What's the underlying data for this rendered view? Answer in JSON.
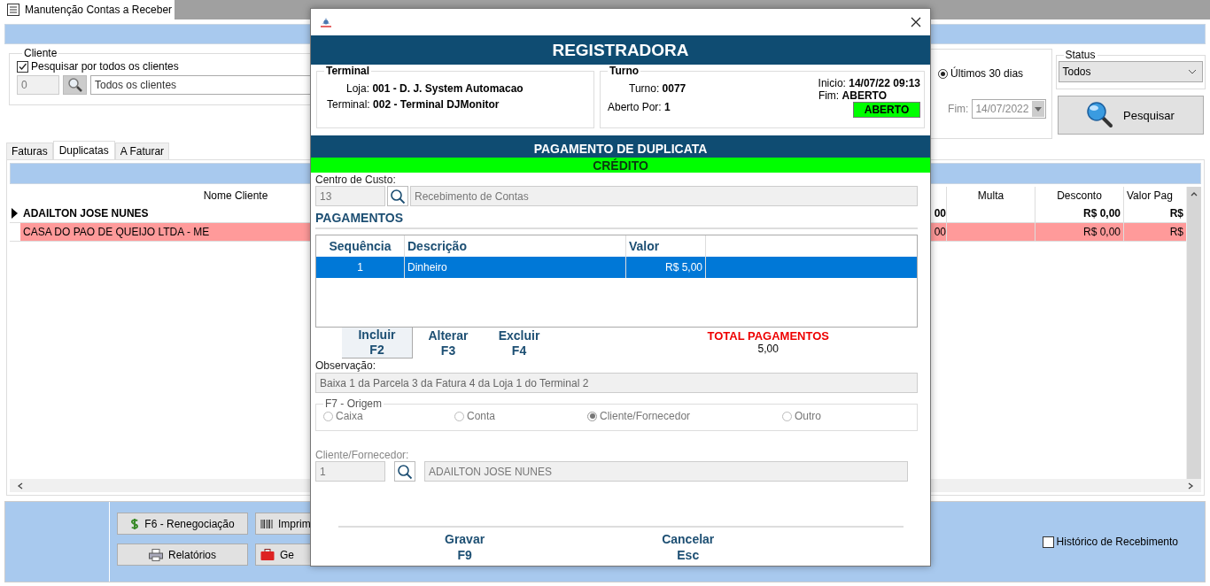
{
  "main_tab": {
    "title": "Manutenção Contas a Receber"
  },
  "cliente": {
    "legend": "Cliente",
    "search_all": {
      "label": "Pesquisar por todos os clientes",
      "checked": true
    },
    "code": "0",
    "name": "Todos os clientes"
  },
  "period": {
    "option": {
      "label": "Últimos 30 dias",
      "selected": true
    },
    "end_label": "Fim:",
    "end_date": "14/07/2022"
  },
  "status": {
    "legend": "Status",
    "value": "Todos"
  },
  "search_button": {
    "label": "Pesquisar"
  },
  "tabs": [
    {
      "label": "Faturas",
      "selected": false
    },
    {
      "label": "Duplicatas",
      "selected": true
    },
    {
      "label": "A Faturar",
      "selected": false
    }
  ],
  "grid": {
    "columns": {
      "nome": "Nome Cliente",
      "multa": "Multa",
      "desconto": "Desconto",
      "valor_pag": "Valor Pag"
    },
    "rows": [
      {
        "nome": "ADAILTON JOSE NUNES",
        "column_2": "00",
        "desconto": "R$ 0,00",
        "valor_pag": "R$",
        "selected": true,
        "highlighted": false
      },
      {
        "nome": "CASA DO PAO DE QUEIJO LTDA - ME",
        "column_2": "00",
        "desconto": "R$ 0,00",
        "valor_pag": "R$",
        "selected": false,
        "highlighted": true
      }
    ]
  },
  "bottom_buttons": [
    {
      "label": "F6 - Renegociação",
      "kind": "money"
    },
    {
      "label": "Imprim",
      "kind": "barcode"
    },
    {
      "label": "Relatórios",
      "kind": "printer"
    },
    {
      "label": "Ge",
      "kind": "case"
    }
  ],
  "historico": {
    "label": "Histórico de Recebimento",
    "checked": false
  },
  "dialog": {
    "title": "REGISTRADORA",
    "terminal": {
      "legend": "Terminal",
      "loja_label": "Loja:",
      "loja": "001 - D. J. System Automacao",
      "terminal_label": "Terminal:",
      "terminal": "002 - Terminal DJMonitor"
    },
    "turno": {
      "legend": "Turno",
      "turno_label": "Turno:",
      "turno": "0077",
      "aberto_por_label": "Aberto Por:",
      "aberto_por": "1",
      "inicio_label": "Inicio:",
      "inicio": "14/07/22 09:13",
      "fim_label": "Fim:",
      "fim": "ABERTO",
      "status": "ABERTO"
    },
    "section": "PAGAMENTO DE DUPLICATA",
    "operation": "CRÉDITO",
    "centro_custo": {
      "label": "Centro de Custo:",
      "code": "13",
      "name": "Recebimento de Contas"
    },
    "pagamentos": {
      "title": "PAGAMENTOS",
      "columns": [
        "Sequência",
        "Descrição",
        "Valor"
      ],
      "rows": [
        {
          "sequencia": "1",
          "descricao": "Dinheiro",
          "valor": "R$ 5,00",
          "selected": true
        }
      ]
    },
    "actions": [
      {
        "label": "Incluir",
        "key": "F2",
        "selected": true
      },
      {
        "label": "Alterar",
        "key": "F3",
        "selected": false
      },
      {
        "label": "Excluir",
        "key": "F4",
        "selected": false
      }
    ],
    "total": {
      "label": "TOTAL PAGAMENTOS",
      "value": "5,00"
    },
    "observacao": {
      "label": "Observação:",
      "value": "Baixa 1 da Parcela 3 da Fatura 4 da Loja 1 do Terminal 2"
    },
    "origem": {
      "legend": "F7 - Origem",
      "options": [
        {
          "label": "Caixa",
          "selected": false
        },
        {
          "label": "Conta",
          "selected": false
        },
        {
          "label": "Cliente/Fornecedor",
          "selected": true
        },
        {
          "label": "Outro",
          "selected": false
        }
      ]
    },
    "cliente_fornecedor": {
      "label": "Cliente/Fornecedor:",
      "code": "1",
      "name": "ADAILTON JOSE NUNES"
    },
    "footer_buttons": [
      {
        "label": "Gravar",
        "key": "F9"
      },
      {
        "label": "Cancelar",
        "key": "Esc"
      }
    ]
  }
}
